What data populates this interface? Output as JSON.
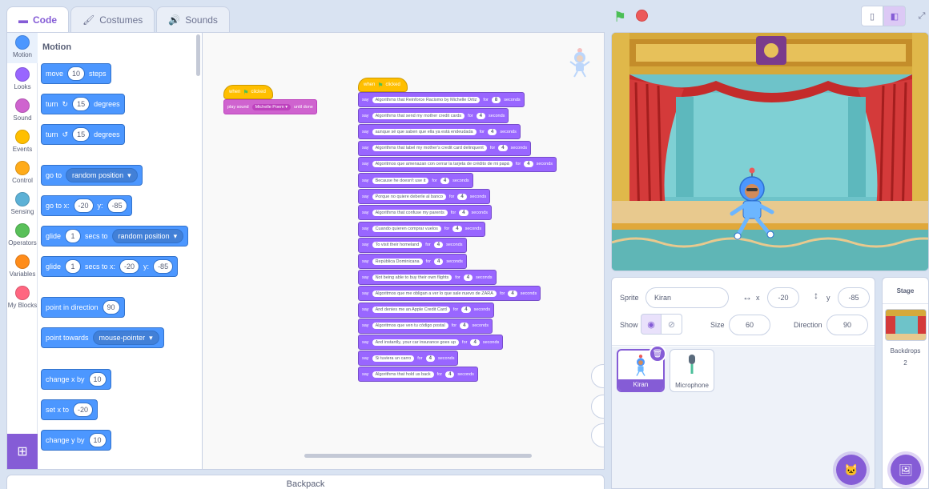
{
  "tabs": [
    {
      "label": "Code",
      "icon": "code-icon"
    },
    {
      "label": "Costumes",
      "icon": "brush-icon"
    },
    {
      "label": "Sounds",
      "icon": "speaker-icon"
    }
  ],
  "categories": [
    {
      "label": "Motion",
      "color": "#4c97ff"
    },
    {
      "label": "Looks",
      "color": "#9966ff"
    },
    {
      "label": "Sound",
      "color": "#cf63cf"
    },
    {
      "label": "Events",
      "color": "#ffbf00"
    },
    {
      "label": "Control",
      "color": "#ffab19"
    },
    {
      "label": "Sensing",
      "color": "#5cb1d6"
    },
    {
      "label": "Operators",
      "color": "#59c059"
    },
    {
      "label": "Variables",
      "color": "#ff8c1a"
    },
    {
      "label": "My Blocks",
      "color": "#ff6680"
    }
  ],
  "palette": {
    "title": "Motion",
    "move": {
      "a": "move",
      "n": "10",
      "b": "steps"
    },
    "turn_right": {
      "a": "turn",
      "n": "15",
      "b": "degrees"
    },
    "turn_left": {
      "a": "turn",
      "n": "15",
      "b": "degrees"
    },
    "goto": {
      "a": "go to",
      "dd": "random position"
    },
    "goto_xy": {
      "a": "go to x:",
      "x": "-20",
      "y_label": "y:",
      "y": "-85"
    },
    "glide_to": {
      "a": "glide",
      "n": "1",
      "b": "secs to",
      "dd": "random position"
    },
    "glide_xy": {
      "a": "glide",
      "n": "1",
      "b": "secs to x:",
      "x": "-20",
      "y_label": "y:",
      "y": "-85"
    },
    "point_dir": {
      "a": "point in direction",
      "n": "90"
    },
    "point_towards": {
      "a": "point towards",
      "dd": "mouse-pointer"
    },
    "change_x": {
      "a": "change x by",
      "n": "10"
    },
    "set_x": {
      "a": "set x to",
      "n": "-20"
    },
    "change_y": {
      "a": "change y by",
      "n": "10"
    }
  },
  "script1": {
    "hat_a": "when",
    "hat_b": "clicked",
    "play_a": "play sound",
    "play_dd": "Michelle Poem",
    "play_b": "until done"
  },
  "script2": {
    "hat_a": "when",
    "hat_b": "clicked",
    "say_label": "say",
    "for_label": "for",
    "seconds_label": "seconds",
    "lines": [
      {
        "text": "Algorithms that Reinforce Racismo by Michelle Ortiz",
        "n": "8"
      },
      {
        "text": "Algorithms that send my mother credit cards",
        "n": "4"
      },
      {
        "text": "aunque sé que saben que ella ya está endeudada",
        "n": "4"
      },
      {
        "text": "Algorithms that label my mother's credit card delinquent",
        "n": "4"
      },
      {
        "text": "Algoritmos que amenazan con cerrar la tarjeta de crédito de mi papá",
        "n": "4"
      },
      {
        "text": "Because he doesn't use it",
        "n": "4"
      },
      {
        "text": "Porque no quiere deberle al banco",
        "n": "4"
      },
      {
        "text": "Algorithms that confuse my parents",
        "n": "4"
      },
      {
        "text": "Cuando quieren comprar vuelos",
        "n": "4"
      },
      {
        "text": "To visit their homeland",
        "n": "4"
      },
      {
        "text": "República Dominicana",
        "n": "4"
      },
      {
        "text": "Not being able to buy their own flights",
        "n": "4"
      },
      {
        "text": "Algoritmos que me obligan a ver lo que sale nuevo de ZARA",
        "n": "4"
      },
      {
        "text": "And denies me an Apple Credit Card",
        "n": "4"
      },
      {
        "text": "Algoritmos que ven tu código postal",
        "n": "4"
      },
      {
        "text": "And instantly, your car insurance goes up",
        "n": "4"
      },
      {
        "text": "Si tuviera un carro",
        "n": "4"
      },
      {
        "text": "Algorithms that hold us back",
        "n": "4"
      }
    ]
  },
  "backpack": "Backpack",
  "sprite_info": {
    "sprite_label": "Sprite",
    "sprite_name": "Kiran",
    "x_label": "x",
    "x": "-20",
    "y_label": "y",
    "y": "-85",
    "show_label": "Show",
    "size_label": "Size",
    "size": "60",
    "direction_label": "Direction",
    "direction": "90"
  },
  "sprites": [
    {
      "name": "Kiran",
      "selected": true
    },
    {
      "name": "Microphone",
      "selected": false
    }
  ],
  "stage_pane": {
    "title": "Stage",
    "backdrops_label": "Backdrops",
    "backdrops_count": "2"
  }
}
